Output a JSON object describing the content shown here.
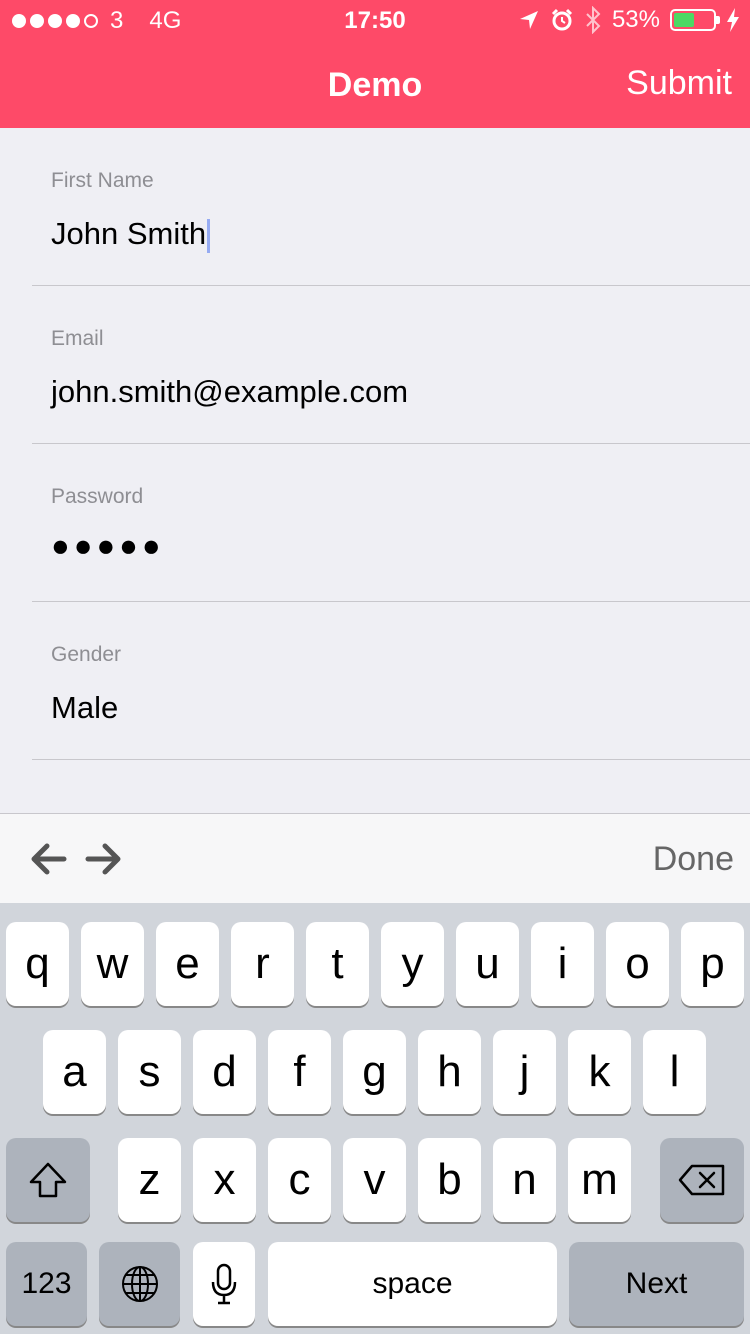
{
  "status_bar": {
    "carrier": "3",
    "network": "4G",
    "time": "17:50",
    "battery_percent": "53%",
    "battery_level": 0.53,
    "icons": [
      "signal-dots-icon",
      "location-arrow-icon",
      "alarm-clock-icon",
      "bluetooth-icon",
      "battery-icon",
      "charging-bolt-icon"
    ]
  },
  "navbar": {
    "title": "Demo",
    "submit_label": "Submit",
    "background_color": "#fe4a68"
  },
  "form": {
    "fields": [
      {
        "label": "First Name",
        "value": "John Smith",
        "focused": true
      },
      {
        "label": "Email",
        "value": "john.smith@example.com"
      },
      {
        "label": "Password",
        "value": "●●●●●"
      },
      {
        "label": "Gender",
        "value": "Male"
      }
    ]
  },
  "accessory": {
    "prev_icon": "arrow-left-icon",
    "next_icon": "arrow-right-icon",
    "done_label": "Done"
  },
  "keyboard": {
    "row1": [
      "q",
      "w",
      "e",
      "r",
      "t",
      "y",
      "u",
      "i",
      "o",
      "p"
    ],
    "row2": [
      "a",
      "s",
      "d",
      "f",
      "g",
      "h",
      "j",
      "k",
      "l"
    ],
    "row3": [
      "z",
      "x",
      "c",
      "v",
      "b",
      "n",
      "m"
    ],
    "shift_icon": "shift-icon",
    "delete_icon": "backspace-icon",
    "numbers_label": "123",
    "globe_icon": "globe-icon",
    "mic_icon": "microphone-icon",
    "space_label": "space",
    "next_label": "Next"
  }
}
